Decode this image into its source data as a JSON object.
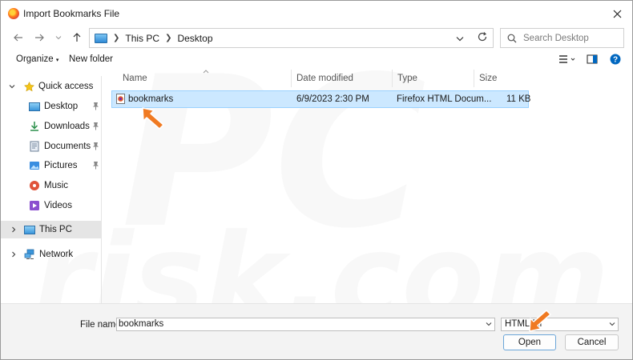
{
  "window": {
    "title": "Import Bookmarks File"
  },
  "nav": {
    "breadcrumb": [
      "This PC",
      "Desktop"
    ],
    "search_placeholder": "Search Desktop"
  },
  "toolbar": {
    "organize_label": "Organize",
    "new_folder_label": "New folder"
  },
  "sidebar": {
    "quick_access": "Quick access",
    "items": [
      {
        "label": "Desktop",
        "icon": "desktop-folder-icon",
        "pinned": true
      },
      {
        "label": "Downloads",
        "icon": "downloads-folder-icon",
        "pinned": true
      },
      {
        "label": "Documents",
        "icon": "documents-folder-icon",
        "pinned": true
      },
      {
        "label": "Pictures",
        "icon": "pictures-folder-icon",
        "pinned": true
      },
      {
        "label": "Music",
        "icon": "music-folder-icon",
        "pinned": false
      },
      {
        "label": "Videos",
        "icon": "videos-folder-icon",
        "pinned": false
      }
    ],
    "this_pc": "This PC",
    "network": "Network"
  },
  "columns": {
    "name": "Name",
    "date": "Date modified",
    "type": "Type",
    "size": "Size"
  },
  "files": [
    {
      "name": "bookmarks",
      "date": "6/9/2023 2:30 PM",
      "type": "Firefox HTML Docum...",
      "size": "11 KB"
    }
  ],
  "footer": {
    "file_name_label": "File name:",
    "file_name_value": "bookmarks",
    "file_type": "HTML Fil",
    "open_label": "Open",
    "cancel_label": "Cancel"
  },
  "colors": {
    "selection": "#cce8ff",
    "accent": "#0067c0",
    "arrow": "#f07a22"
  }
}
